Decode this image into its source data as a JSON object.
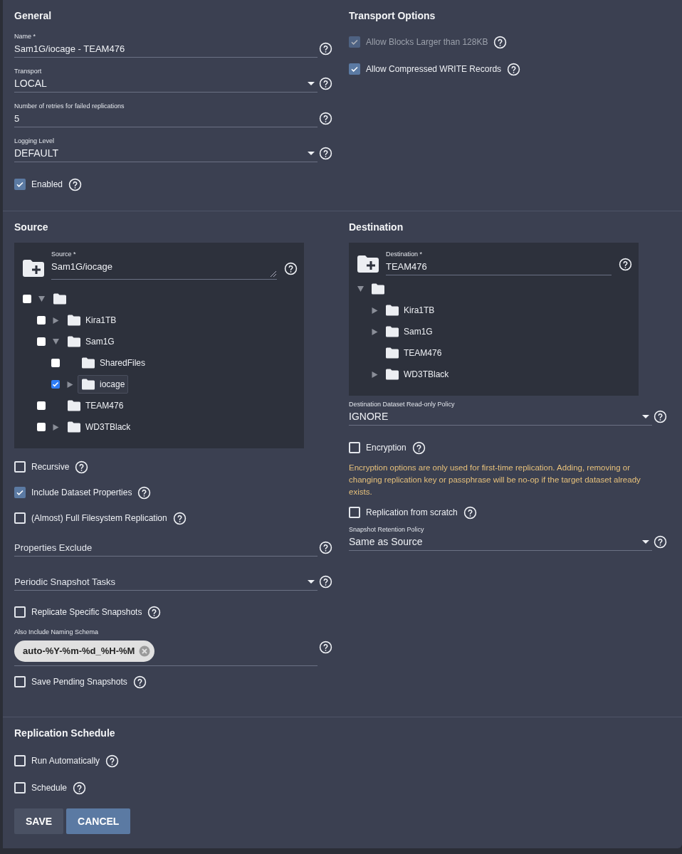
{
  "general": {
    "title": "General",
    "items": [
      {
        "kind": "input",
        "label": "Name *",
        "value": "Sam1G/iocage - TEAM476"
      },
      {
        "kind": "select",
        "label": "Transport",
        "value": "LOCAL"
      },
      {
        "kind": "input",
        "label": "Number of retries for failed replications",
        "value": "5"
      },
      {
        "kind": "select",
        "label": "Logging Level",
        "value": "DEFAULT"
      },
      {
        "kind": "checkbox",
        "label": "Enabled",
        "checked": true,
        "disabled": false
      }
    ]
  },
  "transport_options": {
    "title": "Transport Options",
    "items": [
      {
        "kind": "checkbox",
        "label": "Allow Blocks Larger than 128KB",
        "checked": true,
        "disabled": true
      },
      {
        "kind": "checkbox",
        "label": "Allow Compressed WRITE Records",
        "checked": true,
        "disabled": false
      }
    ]
  },
  "source": {
    "title": "Source",
    "path_field": {
      "label": "Source *",
      "value": "Sam1G/iocage"
    },
    "tree": [
      {
        "checked": false,
        "selected": false,
        "expanded": true,
        "children": [
          {
            "label": "Kira1TB",
            "checked": false,
            "selected": false,
            "expanded": false
          },
          {
            "label": "Sam1G",
            "checked": false,
            "selected": false,
            "expanded": true,
            "children": [
              {
                "label": "SharedFiles",
                "checked": false,
                "selected": false
              },
              {
                "label": "iocage",
                "checked": true,
                "selected": true,
                "expanded": false
              }
            ]
          },
          {
            "label": "TEAM476",
            "checked": false,
            "selected": false
          },
          {
            "label": "WD3TBlack",
            "checked": false,
            "selected": false,
            "expanded": false
          }
        ]
      }
    ],
    "items": [
      {
        "kind": "checkbox",
        "label": "Recursive",
        "checked": false,
        "disabled": false
      },
      {
        "kind": "checkbox",
        "label": "Include Dataset Properties",
        "checked": true,
        "disabled": false
      },
      {
        "kind": "checkbox",
        "label": "(Almost) Full Filesystem Replication",
        "checked": false,
        "disabled": false
      },
      {
        "kind": "input",
        "placeholder": "Properties Exclude"
      },
      {
        "kind": "select",
        "placeholder": "Periodic Snapshot Tasks"
      },
      {
        "kind": "checkbox",
        "label": "Replicate Specific Snapshots",
        "checked": false,
        "disabled": false
      },
      {
        "kind": "chips",
        "label": "Also Include Naming Schema",
        "chips": [
          "auto-%Y-%m-%d_%H-%M"
        ]
      },
      {
        "kind": "checkbox",
        "label": "Save Pending Snapshots",
        "checked": false,
        "disabled": false
      }
    ]
  },
  "destination": {
    "title": "Destination",
    "path_field": {
      "label": "Destination *",
      "value": "TEAM476"
    },
    "tree": [
      {
        "expanded": true,
        "children": [
          {
            "label": "Kira1TB",
            "expanded": false
          },
          {
            "label": "Sam1G",
            "expanded": false
          },
          {
            "label": "TEAM476"
          },
          {
            "label": "WD3TBlack",
            "expanded": false
          }
        ]
      }
    ],
    "items": [
      {
        "kind": "select",
        "label": "Destination Dataset Read-only Policy",
        "value": "IGNORE"
      },
      {
        "kind": "checkbox",
        "label": "Encryption",
        "checked": false,
        "disabled": false
      },
      {
        "kind": "note",
        "text": "Encryption options are only used for first-time replication. Adding, removing or changing replication key or passphrase will be no-op if the target dataset already exists."
      },
      {
        "kind": "checkbox",
        "label": "Replication from scratch",
        "checked": false,
        "disabled": false
      },
      {
        "kind": "select",
        "label": "Snapshot Retention Policy",
        "value": "Same as Source"
      }
    ]
  },
  "replication_schedule": {
    "title": "Replication Schedule",
    "items": [
      {
        "kind": "checkbox",
        "label": "Run Automatically",
        "checked": false,
        "disabled": false
      },
      {
        "kind": "checkbox",
        "label": "Schedule",
        "checked": false,
        "disabled": false
      }
    ]
  },
  "buttons": [
    {
      "label": "SAVE",
      "kind": "secondary"
    },
    {
      "label": "CANCEL",
      "kind": "primary"
    }
  ]
}
